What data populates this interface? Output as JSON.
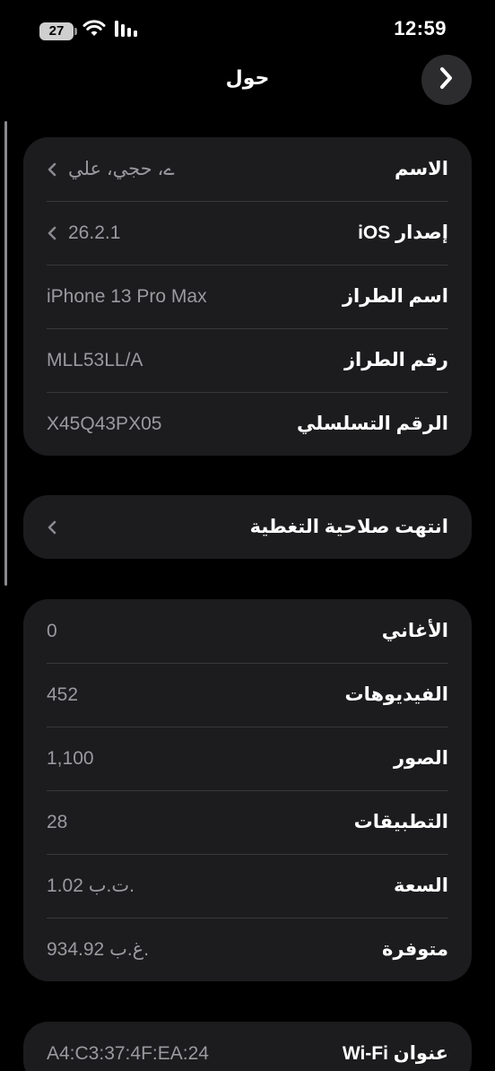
{
  "status_bar": {
    "battery": "27",
    "time": "12:59"
  },
  "nav": {
    "title": "حول",
    "back_icon": "chevron-right-icon"
  },
  "device_info": [
    {
      "label": "الاسم",
      "value": "ے، حجي، علي",
      "chevron": true
    },
    {
      "label": "إصدار iOS",
      "value": "26.2.1",
      "chevron": true
    },
    {
      "label": "اسم الطراز",
      "value": "iPhone 13 Pro Max",
      "chevron": false
    },
    {
      "label": "رقم الطراز",
      "value": "MLL53LL/A",
      "chevron": false
    },
    {
      "label": "الرقم التسلسلي",
      "value": "X45Q43PX05",
      "chevron": false
    }
  ],
  "coverage": {
    "label": "انتهت صلاحية التغطية"
  },
  "media_info": [
    {
      "label": "الأغاني",
      "value": "0"
    },
    {
      "label": "الفيديوهات",
      "value": "452"
    },
    {
      "label": "الصور",
      "value": "1,100"
    },
    {
      "label": "التطبيقات",
      "value": "28"
    },
    {
      "label": "السعة",
      "value": "1.02 ت.ب."
    },
    {
      "label": "متوفرة",
      "value": "934.92 غ.ب."
    }
  ],
  "network_info": [
    {
      "label": "عنوان Wi-Fi",
      "value": "A4:C3:37:4F:EA:24"
    }
  ],
  "colors": {
    "background": "#000000",
    "card": "#1c1c1e",
    "separator": "#38383a",
    "secondary_text": "#9a9a9f"
  }
}
